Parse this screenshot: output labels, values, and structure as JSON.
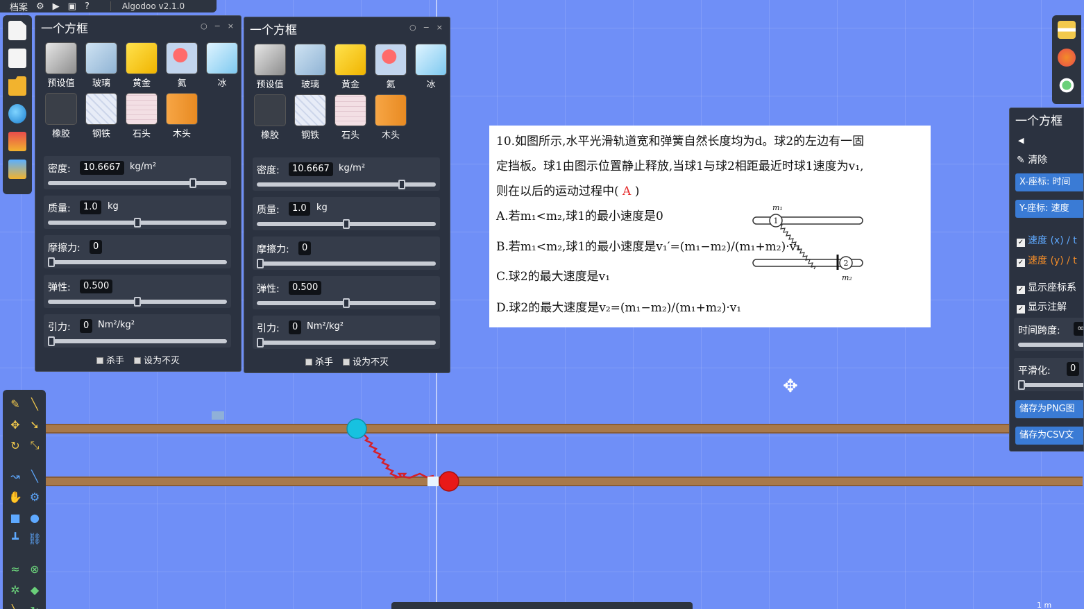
{
  "menubar": {
    "menu_label": "档案",
    "app_title": "Algodoo v2.1.0"
  },
  "material_panels": [
    {
      "title": "一个方框",
      "materials": [
        "预设值",
        "玻璃",
        "黄金",
        "氦",
        "冰",
        "橡胶",
        "钢铁",
        "石头",
        "木头"
      ],
      "density": {
        "label": "密度:",
        "value": "10.6667",
        "unit": "kg/m²",
        "level": 0.81
      },
      "mass": {
        "label": "质量:",
        "value": "1.0",
        "unit": "kg",
        "level": 0.5
      },
      "friction": {
        "label": "摩擦力:",
        "value": "0",
        "level": 0.0
      },
      "restitution": {
        "label": "弹性:",
        "value": "0.500",
        "level": 0.5
      },
      "attraction": {
        "label": "引力:",
        "value": "0",
        "unit": "Nm²/kg²",
        "level": 0.0
      },
      "killer_label": "杀手",
      "immortal_label": "设为不灭"
    },
    {
      "title": "一个方框",
      "materials": [
        "预设值",
        "玻璃",
        "黄金",
        "氦",
        "冰",
        "橡胶",
        "钢铁",
        "石头",
        "木头"
      ],
      "density": {
        "label": "密度:",
        "value": "10.6667",
        "unit": "kg/m²",
        "level": 0.81
      },
      "mass": {
        "label": "质量:",
        "value": "1.0",
        "unit": "kg",
        "level": 0.5
      },
      "friction": {
        "label": "摩擦力:",
        "value": "0",
        "level": 0.0
      },
      "restitution": {
        "label": "弹性:",
        "value": "0.500",
        "level": 0.5
      },
      "attraction": {
        "label": "引力:",
        "value": "0",
        "unit": "Nm²/kg²",
        "level": 0.0
      },
      "killer_label": "杀手",
      "immortal_label": "设为不灭"
    }
  ],
  "question": {
    "line1": "10.如图所示,水平光滑轨道宽和弹簧自然长度均为d。球2的左边有一固",
    "line2": "定挡板。球1由图示位置静止释放,当球1与球2相距最近时球1速度为v₁,",
    "line3_prefix": "则在以后的运动过程中(",
    "answer": "A",
    "line3_suffix": ")",
    "option_a": "A.若m₁<m₂,球1的最小速度是0",
    "option_b": "B.若m₁<m₂,球1的最小速度是v₁′=(m₁−m₂)/(m₁+m₂)·v₁",
    "option_c": "C.球2的最大速度是v₁",
    "option_d": "D.球2的最大速度是v₂=(m₁−m₂)/(m₁+m₂)·v₁",
    "diagram_m1": "m₁",
    "diagram_m2": "m₂",
    "diagram_ball1": "1",
    "diagram_ball2": "2"
  },
  "graph_panel": {
    "title": "一个方框",
    "clear_label": "清除",
    "x_axis_button": "X-座标: 时间",
    "y_axis_button": "Y-座标: 速度",
    "series1": "速度 (x) / t",
    "series2": "速度 (y) / t",
    "series1_color": "#5ea9ff",
    "series2_color": "#f28c28",
    "show_axes": "显示座标系",
    "show_annotations": "显示注解",
    "time_span_label": "时间跨度:",
    "time_span_value": "∞",
    "smoothing_label": "平滑化:",
    "smoothing_value": "0",
    "save_png": "储存为PNG图",
    "save_csv": "储存为CSV文"
  },
  "scale_label": "1 m",
  "colors": {
    "background": "#6f8ff7",
    "ball1": "#17c1e0",
    "ball2": "#e81919",
    "spring": "#d4202a",
    "track": "#a8794a"
  }
}
